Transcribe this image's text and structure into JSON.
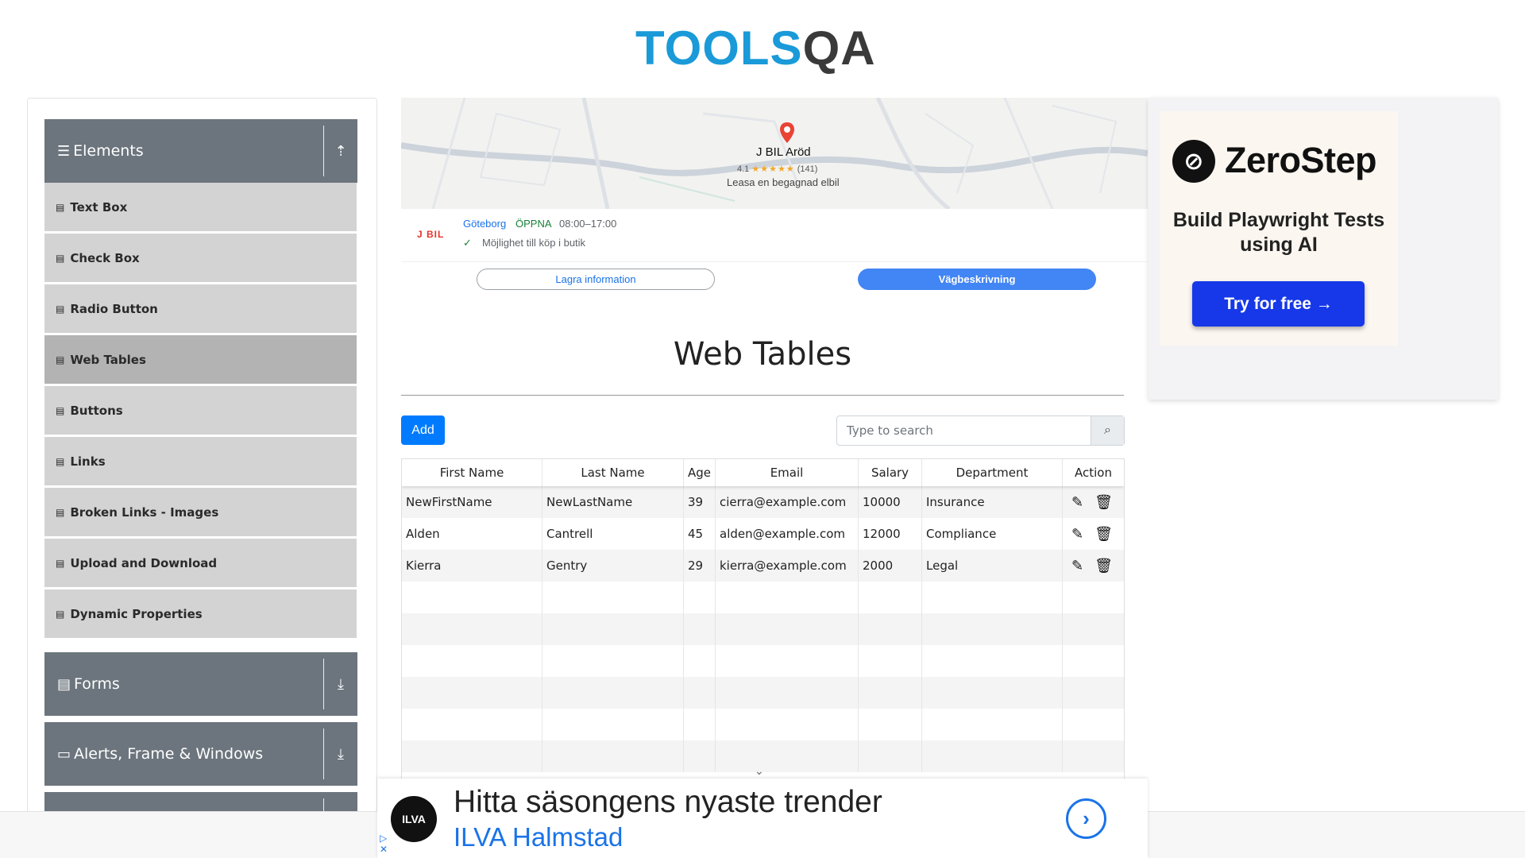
{
  "header": {
    "logo_text_blue": "TOOLS",
    "logo_text_dark": "QA"
  },
  "sidebar": {
    "groups": [
      {
        "label": "Elements",
        "icon": "menu-icon",
        "toggle": "collapse-up-icon"
      },
      {
        "label": "Forms",
        "icon": "form-icon",
        "toggle": "expand-down-icon"
      },
      {
        "label": "Alerts, Frame & Windows",
        "icon": "window-icon",
        "toggle": "expand-down-icon"
      }
    ],
    "items": [
      {
        "label": "Text Box"
      },
      {
        "label": "Check Box"
      },
      {
        "label": "Radio Button"
      },
      {
        "label": "Web Tables",
        "active": true
      },
      {
        "label": "Buttons"
      },
      {
        "label": "Links"
      },
      {
        "label": "Broken Links - Images"
      },
      {
        "label": "Upload and Download"
      },
      {
        "label": "Dynamic Properties"
      }
    ]
  },
  "map_ad": {
    "place_name": "J BIL Aröd",
    "rating": "4.1",
    "stars": "★★★★★",
    "review_count": "(141)",
    "subtitle": "Leasa en begagnad elbil",
    "brand": "J BIL",
    "city": "Göteborg",
    "open_status": "ÖPPNA",
    "hours": "08:00–17:00",
    "feature": "Möjlighet till köp i butik",
    "save_button": "Lagra information",
    "route_button": "Vägbeskrivning"
  },
  "zerostep_ad": {
    "brand": "ZeroStep",
    "tagline": "Build Playwright Tests using AI",
    "cta": "Try for free →"
  },
  "main": {
    "title": "Web Tables",
    "add_button": "Add",
    "search_placeholder": "Type to search",
    "table": {
      "columns": [
        "First Name",
        "Last Name",
        "Age",
        "Email",
        "Salary",
        "Department",
        "Action"
      ],
      "rows": [
        [
          "NewFirstName",
          "NewLastName",
          "39",
          "cierra@example.com",
          "10000",
          "Insurance"
        ],
        [
          "Alden",
          "Cantrell",
          "45",
          "alden@example.com",
          "12000",
          "Compliance"
        ],
        [
          "Kierra",
          "Gentry",
          "29",
          "kierra@example.com",
          "2000",
          "Legal"
        ]
      ],
      "empty_rows": 6
    }
  },
  "bottom_ad": {
    "logo": "ILVA",
    "headline": "Hitta säsongens nyaste trender",
    "store": "ILVA Halmstad"
  },
  "colors": {
    "accent": "#007bff",
    "sidebar_header": "#6c757d",
    "sidebar_item": "#d3d3d3",
    "sidebar_item_active": "#b3b3b3",
    "logo_blue": "#1a9ad8"
  }
}
